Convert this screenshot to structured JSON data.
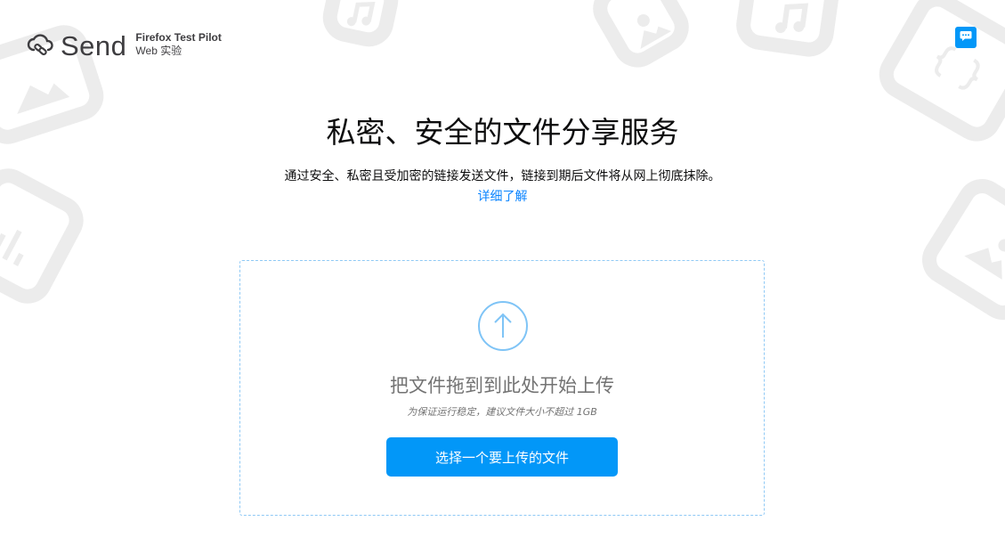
{
  "app": {
    "logo_text": "Send",
    "pilot_title": "Firefox Test Pilot",
    "pilot_subtitle": "Web 实验"
  },
  "hero": {
    "title": "私密、安全的文件分享服务",
    "description": "通过安全、私密且受加密的链接发送文件，链接到期后文件将从网上彻底抹除。",
    "learn_more": "详细了解"
  },
  "upload": {
    "drop_text": "把文件拖到到此处开始上传",
    "size_note": "为保证运行稳定，建议文件大小不超过 1GB",
    "choose_button": "选择一个要上传的文件"
  },
  "colors": {
    "accent": "#0297f8",
    "link": "#0a84ff",
    "dropzone_border": "#8fc9f5",
    "upload_icon": "#7fc4f6",
    "background_decoration": "#ececec"
  },
  "icons": {
    "logo": "cloud-link-icon",
    "feedback": "chat-bubble-icon",
    "upload": "arrow-up-circle-icon",
    "decorations": [
      "image-file-icon",
      "music-file-icon",
      "chart-file-icon",
      "code-file-icon"
    ]
  }
}
